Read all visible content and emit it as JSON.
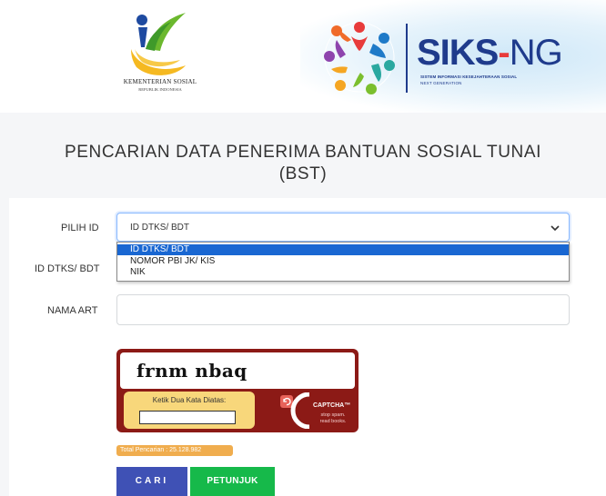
{
  "header": {
    "left_logo_name": "KEMENTERIAN SOSIAL",
    "left_logo_sub": "REPUBLIK INDONESIA",
    "right_logo_word_a": "SIKS",
    "right_logo_word_b": "-",
    "right_logo_word_c": "NG",
    "right_logo_sub1": "SISTEM INFORMASI KESEJAHTERAAN SOSIAL",
    "right_logo_sub2": "NEXT GENERATION"
  },
  "page": {
    "title_line1": "PENCARIAN DATA PENERIMA BANTUAN SOSIAL TUNAI",
    "title_line2": "(BST)"
  },
  "form": {
    "pilih_id_label": "PILIH ID",
    "id_dtks_label": "ID DTKS/ BDT",
    "nama_art_label": "NAMA ART",
    "select_value": "ID DTKS/ BDT",
    "options": [
      "ID DTKS/ BDT",
      "NOMOR PBI JK/ KIS",
      "NIK"
    ],
    "nama_value": ""
  },
  "captcha": {
    "words": "frnm nbaq",
    "prompt": "Ketik Dua Kata Diatas:",
    "brand": "CAPTCHA™",
    "slogan1": "stop spam.",
    "slogan2": "read books."
  },
  "stats": {
    "total_label": "Total Pencarian : 25.128.982"
  },
  "buttons": {
    "search": "CARI",
    "help": "PETUNJUK"
  },
  "colors": {
    "primary": "#3f51b5",
    "success": "#16b94a",
    "badge": "#f0ad4e",
    "captcha_bg": "#8c1a16",
    "captcha_panel": "#f8d77b",
    "siks_blue": "#1f3b8c",
    "siks_red": "#e83b3b"
  }
}
